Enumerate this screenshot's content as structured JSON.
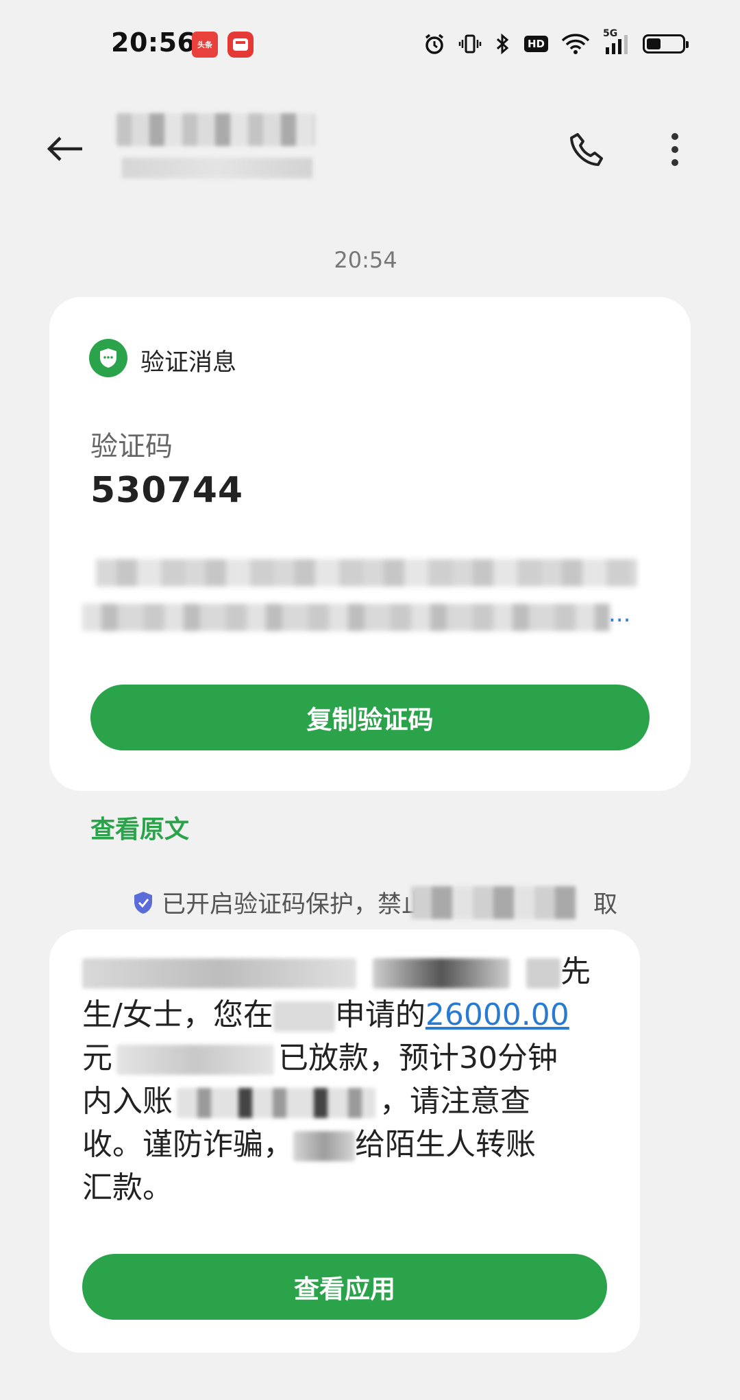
{
  "status_bar": {
    "time": "20:56",
    "notif_1": "头条",
    "notif_2": "云闪付",
    "signal_label": "5G",
    "hd_label": "HD",
    "battery_level": 0.4
  },
  "header": {
    "back_icon": "arrow-left-icon",
    "call_icon": "phone-icon",
    "menu_icon": "more-vertical-icon"
  },
  "message_time": "20:54",
  "verification_card": {
    "title": "验证消息",
    "code_label": "验证码",
    "code_value": "530744",
    "ellipsis": "...",
    "copy_button": "复制验证码"
  },
  "view_original": "查看原文",
  "protection_notice": {
    "text_visible": "已开启验证码保护，禁止第",
    "text_tail": "取"
  },
  "second_message": {
    "line1_tail": "先",
    "line2_a": "生/女士，您在",
    "line2_b": "申请的",
    "amount": "26000.00",
    "line3_a": "元",
    "line3_b": "已放款，预计30分钟",
    "line4_a": "内入账",
    "line4_b": "，请注意查",
    "line5_a": "收。谨防诈骗，",
    "line5_b": "给陌生人转账",
    "line6": "汇款。",
    "button": "查看应用"
  },
  "colors": {
    "accent_green": "#2aa34b",
    "link_blue": "#2a7bd0",
    "background": "#f1f1f1"
  }
}
